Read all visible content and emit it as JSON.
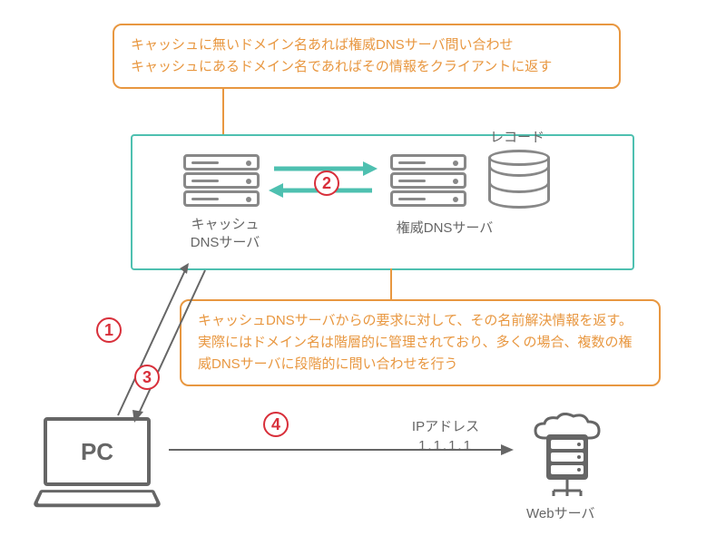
{
  "callouts": {
    "top": "キャッシュに無いドメイン名あれば権威DNSサーバ問い合わせ\nキャッシュにあるドメイン名であればその情報をクライアントに返す",
    "mid": "キャッシュDNSサーバからの要求に対して、その名前解決情報を返す。実際にはドメイン名は階層的に管理されており、多くの場合、複数の権威DNSサーバに段階的に問い合わせを行う"
  },
  "labels": {
    "record": "レコード",
    "cache_server": "キャッシュ\nDNSサーバ",
    "auth_server": "権威DNSサーバ",
    "ip_title": "IPアドレス",
    "ip_value": "1.1.1.1",
    "web_server": "Webサーバ",
    "pc": "PC"
  },
  "steps": {
    "s1": "1",
    "s2": "2",
    "s3": "3",
    "s4": "4"
  },
  "colors": {
    "orange": "#e89740",
    "teal": "#4ec0b0",
    "red": "#d82f3a",
    "gray": "#666"
  }
}
